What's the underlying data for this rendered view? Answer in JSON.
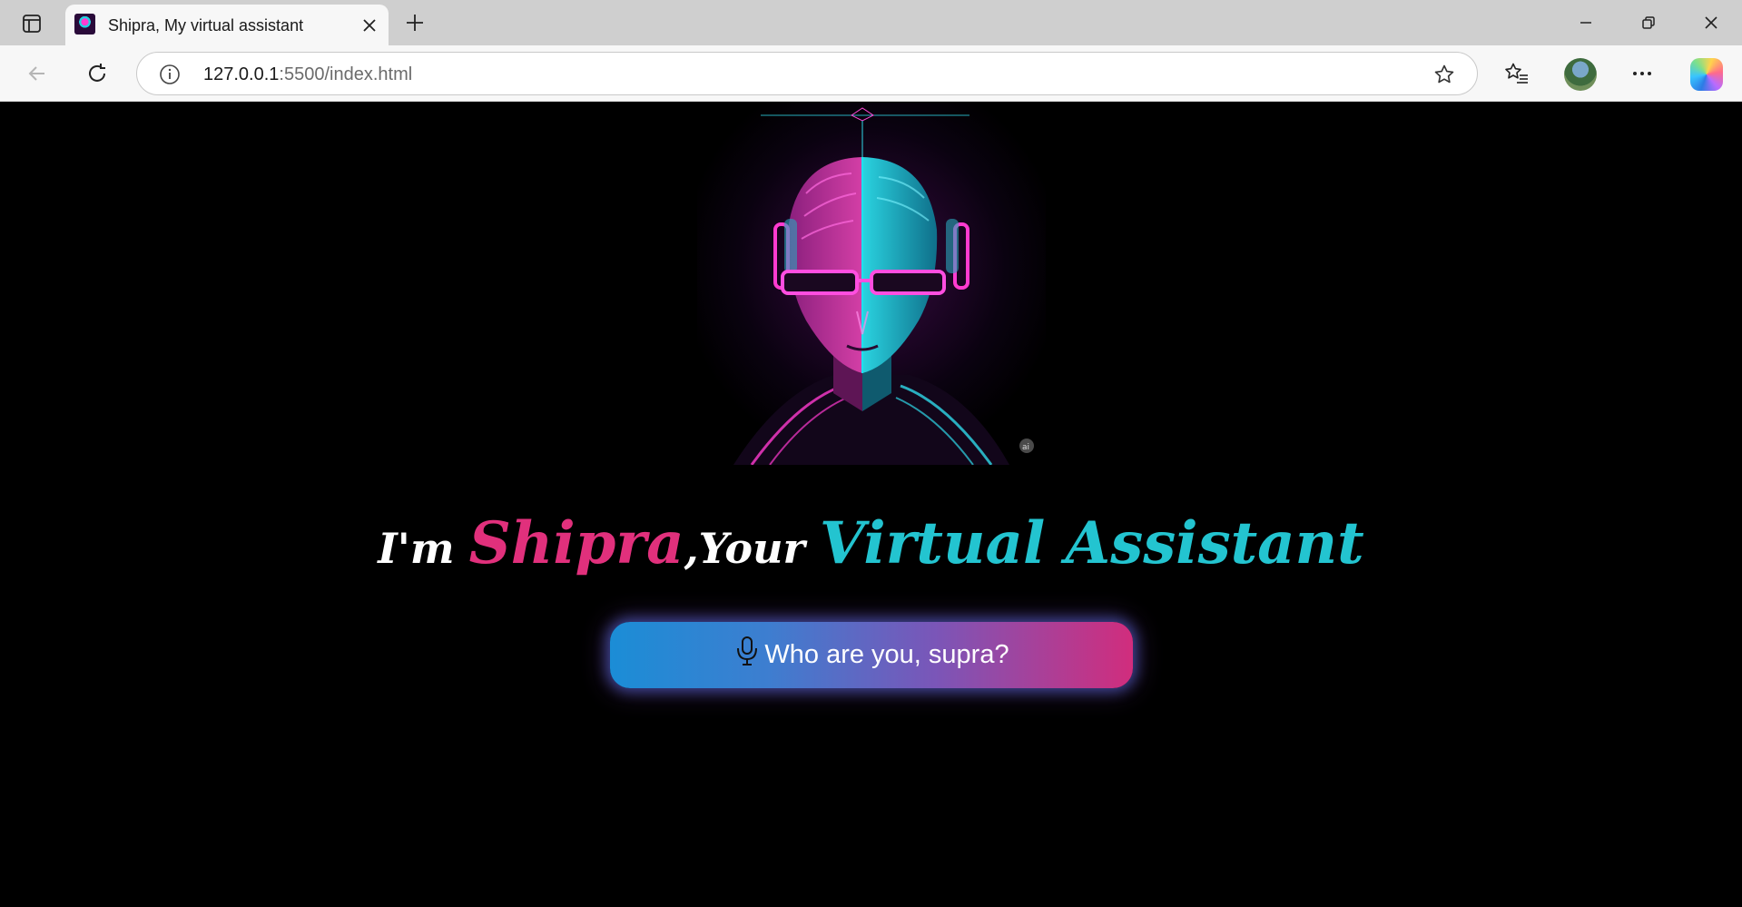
{
  "browser": {
    "tab": {
      "title": "Shipra, My virtual assistant"
    },
    "address": {
      "host": "127.0.0.1",
      "rest": ":5500/index.html"
    }
  },
  "hero": {
    "headline": {
      "part1": "I'm ",
      "part2": "Shipra",
      "part3": ",Your ",
      "part4": "Virtual Assistant"
    },
    "button": {
      "label": "Who are you, supra?"
    }
  },
  "colors": {
    "name_pink": "#e1307c",
    "title_cyan": "#23c4d0",
    "button_start": "#1b8dd6",
    "button_end": "#d12d7d"
  },
  "icons": {
    "sidebar": "sidebar-icon",
    "close": "close-icon",
    "new_tab": "plus-icon",
    "back": "back-arrow-icon",
    "refresh": "refresh-icon",
    "info": "info-icon",
    "favorite": "star-icon",
    "favorites_list": "favorites-icon",
    "more": "more-icon",
    "mic": "microphone-icon"
  }
}
